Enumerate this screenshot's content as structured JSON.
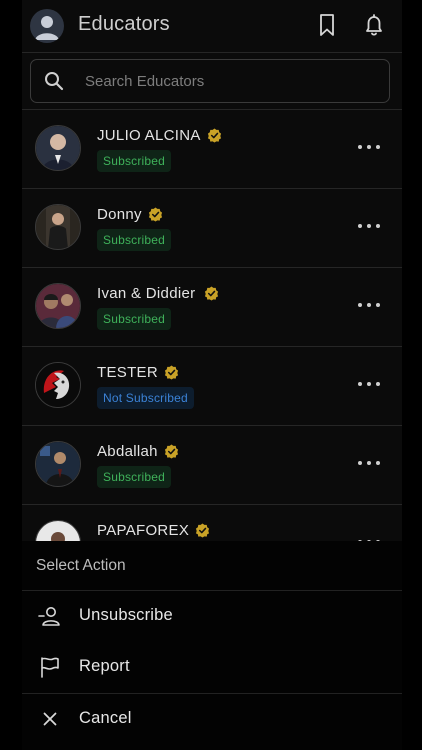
{
  "header": {
    "title": "Educators",
    "icons": [
      "user-avatar-icon",
      "bookmark-icon",
      "bell-icon"
    ]
  },
  "search": {
    "placeholder": "Search Educators",
    "value": ""
  },
  "colors": {
    "background": "#0b0b0b",
    "verified": "#c9a227",
    "subscribed_text": "#3fb15a",
    "subscribed_bg": "#0f2417",
    "not_subscribed_text": "#3b82d6",
    "not_subscribed_bg": "#0d1d2e"
  },
  "educators": [
    {
      "name": "JULIO ALCINA",
      "status": "Subscribed",
      "subscribed": true
    },
    {
      "name": "Donny",
      "status": "Subscribed",
      "subscribed": true
    },
    {
      "name": "Ivan & Diddier",
      "status": "Subscribed",
      "subscribed": true
    },
    {
      "name": "TESTER",
      "status": "Not Subscribed",
      "subscribed": false
    },
    {
      "name": "Abdallah",
      "status": "Subscribed",
      "subscribed": true
    },
    {
      "name": "PAPAFOREX",
      "status": "",
      "subscribed": true
    }
  ],
  "action_sheet": {
    "title": "Select Action",
    "actions": [
      {
        "label": "Unsubscribe",
        "icon": "user-minus-icon"
      },
      {
        "label": "Report",
        "icon": "flag-icon"
      },
      {
        "label": "Cancel",
        "icon": "close-icon"
      }
    ]
  }
}
